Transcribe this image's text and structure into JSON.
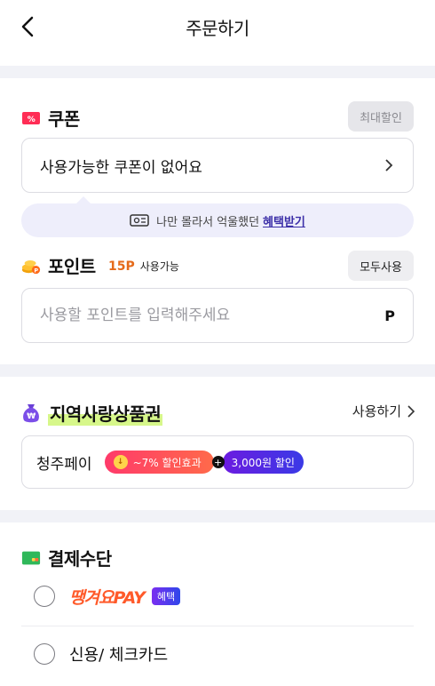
{
  "header": {
    "title": "주문하기"
  },
  "coupon": {
    "section_title": "쿠폰",
    "max_discount_label": "최대할인",
    "status_text": "사용가능한 쿠폰이 없어요",
    "benefit_text": "나만 몰라서 억울했던",
    "benefit_link": "혜택받기"
  },
  "point": {
    "section_title": "포인트",
    "available_amount": "15P",
    "available_label": "사용가능",
    "use_all_label": "모두사용",
    "input_placeholder": "사용할 포인트를 입력해주세요",
    "input_value": "",
    "unit": "P"
  },
  "local_voucher": {
    "section_title": "지역사랑상품권",
    "use_link": "사용하기",
    "pay_name": "청주페이",
    "discount_tag": "~7% 할인효과",
    "plus": "+",
    "cash_tag": "3,000원 할인"
  },
  "payment": {
    "section_title": "결제수단",
    "options": [
      {
        "logo_text": "땡겨요PAY",
        "badge": "혜택"
      },
      {
        "label": "신용/ 체크카드"
      }
    ]
  },
  "colors": {
    "accent_purple": "#3c2fa8",
    "point_orange": "#e56a1a",
    "highlight_green": "#d7f78a",
    "divider": "#f1f2f7"
  }
}
